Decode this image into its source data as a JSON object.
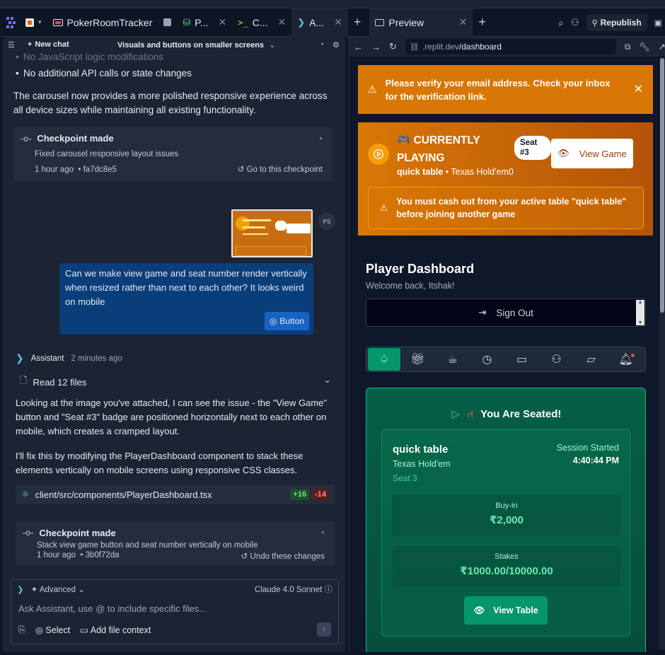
{
  "tabs": {
    "project": "PokerRoomTracker",
    "t1": "P...",
    "t2": "C...",
    "t3": "A...",
    "preview": "Preview",
    "republish": "Republish"
  },
  "chat": {
    "new_chat": "New chat",
    "title": "Visuals and buttons on smaller screens",
    "bullet_faded": "No JavaScript logic modifications",
    "bullet2": "No additional API calls or state changes",
    "summary": "The carousel now provides a more polished responsive experience across all device sizes while maintaining all existing functionality.",
    "checkpoint1": {
      "title": "Checkpoint made",
      "desc": "Fixed carousel responsive layout issues",
      "time": "1 hour ago",
      "hash": "• fa7dc8e5",
      "action": "Go to this checkpoint"
    },
    "avatar_initials": "PS",
    "user_message": "Can we make view game and seat number render vertically when resized rather than next to each other? It looks weird on mobile",
    "button_chip": "Button",
    "assistant_name": "Assistant",
    "assistant_time": "2 minutes ago",
    "read_files": "Read 12 files",
    "reply1": "Looking at the image you've attached, I can see the issue - the \"View Game\" button and \"Seat #3\" badge are positioned horizontally next to each other on mobile, which creates a cramped layout.",
    "reply2": "I'll fix this by modifying the PlayerDashboard component to stack these elements vertically on mobile screens using responsive CSS classes.",
    "file": {
      "path": "client/src/components/PlayerDashboard.tsx",
      "added": "+16",
      "removed": "-14"
    },
    "checkpoint2": {
      "title": "Checkpoint made",
      "desc": "Stack view game button and seat number vertically on mobile",
      "time": "1 hour ago",
      "hash": "• 3b0f72da",
      "action": "Undo these changes"
    },
    "input": {
      "advanced": "Advanced",
      "model": "Claude 4.0 Sonnet",
      "placeholder": "Ask Assistant, use @ to include specific files...",
      "select": "Select",
      "add_context": "Add file context"
    }
  },
  "preview": {
    "url_prefix": ".replit.dev",
    "url_path": "/dashboard",
    "verify_text": "Please verify your email address. Check your inbox for the verification link.",
    "playing": {
      "title": "🎮 CURRENTLY PLAYING",
      "table": "quick table",
      "game": "Texas Hold'em0",
      "seat_badge": "Seat #3",
      "view_game": "View Game",
      "cashout": "You must cash out from your active table \"quick table\" before joining another game"
    },
    "dashboard": {
      "title": "Player Dashboard",
      "welcome": "Welcome back, Itshak!",
      "sign_out": "Sign Out"
    },
    "seated": {
      "heading": "You Are Seated!",
      "table_name": "quick table",
      "game": "Texas Hold'em",
      "seat": "Seat 3",
      "session_label": "Session Started",
      "session_time": "4:40:44 PM",
      "buyin_label": "Buy-in",
      "buyin_value": "₹2,000",
      "stakes_label": "Stakes",
      "stakes_value": "₹1000.00/10000.00",
      "view_table": "View Table"
    },
    "colors": {
      "amber": "#d97706",
      "emerald": "#059669"
    }
  }
}
